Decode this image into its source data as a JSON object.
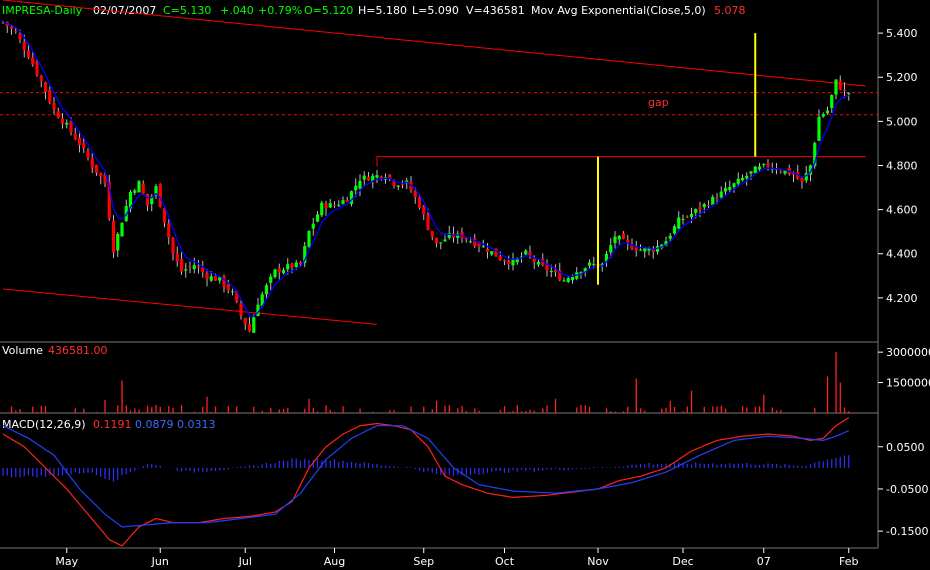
{
  "header": {
    "symbol": "IMPRESA-Daily",
    "date": "02/07/2007",
    "close": "C=5.130",
    "change": "+.040",
    "change_pct": "+0.79%",
    "open": "O=5.120",
    "high": "H=5.180",
    "low": "L=5.090",
    "volume": "V=436581",
    "indicator": "Mov Avg Exponential(Close,5,0)",
    "indicator_value": "5.078"
  },
  "volume_panel": {
    "title": "Volume",
    "value": "436581.00"
  },
  "macd_panel": {
    "title": "MACD(12,26,9)",
    "v1": "0.1191",
    "v2": "0.0879",
    "v3": "0.0313"
  },
  "annotation": {
    "gap_label": "gap"
  },
  "colors": {
    "background": "#000000",
    "up_candle": "#00ff00",
    "down_candle": "#ff0000",
    "ema": "#0000ff",
    "trendline": "#ff0000",
    "marker": "#ffff00",
    "axis_text": "#ffffff"
  },
  "chart_data": [
    {
      "type": "candlestick",
      "title": "IMPRESA-Daily",
      "ylim": [
        4.0,
        5.55
      ],
      "yticks": [
        "4.200",
        "4.400",
        "4.600",
        "4.800",
        "5.000",
        "5.200",
        "5.400"
      ],
      "ytick_values": [
        4.2,
        4.4,
        4.6,
        4.8,
        5.0,
        5.2,
        5.4
      ],
      "xticks": [
        "May",
        "Jun",
        "Jul",
        "Aug",
        "Sep",
        "Oct",
        "Nov",
        "Dec",
        "07",
        "Feb"
      ],
      "anchors": [
        [
          0,
          5.45
        ],
        [
          3,
          5.4
        ],
        [
          6,
          5.3
        ],
        [
          9,
          5.18
        ],
        [
          12,
          5.05
        ],
        [
          15,
          4.98
        ],
        [
          18,
          4.9
        ],
        [
          21,
          4.8
        ],
        [
          24,
          4.72
        ],
        [
          26,
          4.42
        ],
        [
          28,
          4.55
        ],
        [
          30,
          4.68
        ],
        [
          32,
          4.72
        ],
        [
          34,
          4.62
        ],
        [
          36,
          4.7
        ],
        [
          38,
          4.55
        ],
        [
          40,
          4.4
        ],
        [
          42,
          4.32
        ],
        [
          45,
          4.35
        ],
        [
          48,
          4.3
        ],
        [
          51,
          4.28
        ],
        [
          54,
          4.22
        ],
        [
          56,
          4.12
        ],
        [
          58,
          4.05
        ],
        [
          60,
          4.18
        ],
        [
          62,
          4.25
        ],
        [
          64,
          4.32
        ],
        [
          67,
          4.34
        ],
        [
          70,
          4.35
        ],
        [
          72,
          4.5
        ],
        [
          75,
          4.62
        ],
        [
          78,
          4.62
        ],
        [
          81,
          4.65
        ],
        [
          84,
          4.74
        ],
        [
          87,
          4.75
        ],
        [
          90,
          4.76
        ],
        [
          92,
          4.72
        ],
        [
          95,
          4.72
        ],
        [
          98,
          4.62
        ],
        [
          100,
          4.52
        ],
        [
          102,
          4.44
        ],
        [
          105,
          4.48
        ],
        [
          108,
          4.48
        ],
        [
          111,
          4.45
        ],
        [
          114,
          4.42
        ],
        [
          117,
          4.38
        ],
        [
          120,
          4.36
        ],
        [
          123,
          4.4
        ],
        [
          126,
          4.35
        ],
        [
          129,
          4.32
        ],
        [
          132,
          4.28
        ],
        [
          135,
          4.32
        ],
        [
          138,
          4.35
        ],
        [
          141,
          4.35
        ],
        [
          144,
          4.48
        ],
        [
          147,
          4.44
        ],
        [
          150,
          4.42
        ],
        [
          153,
          4.42
        ],
        [
          156,
          4.46
        ],
        [
          159,
          4.55
        ],
        [
          162,
          4.58
        ],
        [
          165,
          4.62
        ],
        [
          168,
          4.66
        ],
        [
          171,
          4.7
        ],
        [
          174,
          4.74
        ],
        [
          177,
          4.78
        ],
        [
          180,
          4.8
        ],
        [
          183,
          4.78
        ],
        [
          186,
          4.76
        ],
        [
          188,
          4.72
        ],
        [
          190,
          4.8
        ],
        [
          192,
          5.02
        ],
        [
          194,
          5.05
        ],
        [
          196,
          5.18
        ],
        [
          198,
          5.13
        ]
      ],
      "series": [
        {
          "name": "Mov Avg Exponential(Close,5,0)",
          "last": 5.078
        }
      ],
      "annotations": {
        "trendline_top": [
          [
            0,
            5.55
          ],
          [
            203,
            5.16
          ]
        ],
        "trendline_bottom": [
          [
            0,
            4.24
          ],
          [
            88,
            4.08
          ]
        ],
        "resistance": {
          "y": 4.84,
          "x": [
            88,
            203
          ]
        },
        "gap_lines": [
          5.13,
          5.03
        ],
        "gap_label": "gap",
        "marker_lines": [
          {
            "x": 140,
            "y0": 4.26,
            "y1": 4.84
          },
          {
            "x": 177,
            "y0": 4.84,
            "y1": 5.4
          }
        ]
      }
    },
    {
      "type": "bar",
      "title": "Volume",
      "last_value": 436581.0,
      "ylim": [
        0,
        3500000
      ],
      "yticks": [
        "3000000",
        "1500000"
      ],
      "ytick_values": [
        3000000,
        1500000
      ],
      "spikes": [
        [
          24,
          650000
        ],
        [
          28,
          1600000
        ],
        [
          48,
          800000
        ],
        [
          72,
          700000
        ],
        [
          102,
          600000
        ],
        [
          130,
          700000
        ],
        [
          149,
          1700000
        ],
        [
          157,
          600000
        ],
        [
          162,
          1100000
        ],
        [
          179,
          900000
        ],
        [
          194,
          1800000
        ],
        [
          196,
          3000000
        ],
        [
          197,
          1500000
        ]
      ]
    },
    {
      "type": "line",
      "title": "MACD(12,26,9)",
      "ylim": [
        -0.19,
        0.13
      ],
      "yticks": [
        "0.0500",
        "-0.0500",
        "-0.1500"
      ],
      "ytick_values": [
        0.05,
        -0.05,
        -0.15
      ],
      "series": [
        {
          "name": "0.1191",
          "points": [
            [
              0,
              0.08
            ],
            [
              5,
              0.05
            ],
            [
              10,
              0.0
            ],
            [
              15,
              -0.05
            ],
            [
              20,
              -0.11
            ],
            [
              25,
              -0.17
            ],
            [
              28,
              -0.185
            ],
            [
              32,
              -0.14
            ],
            [
              36,
              -0.12
            ],
            [
              40,
              -0.13
            ],
            [
              46,
              -0.13
            ],
            [
              52,
              -0.12
            ],
            [
              58,
              -0.115
            ],
            [
              64,
              -0.105
            ],
            [
              68,
              -0.08
            ],
            [
              72,
              0.0
            ],
            [
              76,
              0.05
            ],
            [
              80,
              0.08
            ],
            [
              84,
              0.1
            ],
            [
              88,
              0.105
            ],
            [
              92,
              0.1
            ],
            [
              96,
              0.09
            ],
            [
              100,
              0.05
            ],
            [
              104,
              -0.02
            ],
            [
              108,
              -0.04
            ],
            [
              114,
              -0.06
            ],
            [
              120,
              -0.07
            ],
            [
              128,
              -0.065
            ],
            [
              136,
              -0.055
            ],
            [
              140,
              -0.05
            ],
            [
              145,
              -0.03
            ],
            [
              150,
              -0.02
            ],
            [
              156,
              0.0
            ],
            [
              162,
              0.04
            ],
            [
              168,
              0.065
            ],
            [
              174,
              0.075
            ],
            [
              180,
              0.08
            ],
            [
              186,
              0.075
            ],
            [
              190,
              0.065
            ],
            [
              193,
              0.07
            ],
            [
              196,
              0.1
            ],
            [
              199,
              0.119
            ]
          ]
        },
        {
          "name": "0.0879",
          "points": [
            [
              0,
              0.1
            ],
            [
              6,
              0.07
            ],
            [
              12,
              0.03
            ],
            [
              18,
              -0.05
            ],
            [
              24,
              -0.11
            ],
            [
              28,
              -0.14
            ],
            [
              34,
              -0.135
            ],
            [
              40,
              -0.13
            ],
            [
              48,
              -0.13
            ],
            [
              56,
              -0.12
            ],
            [
              64,
              -0.11
            ],
            [
              70,
              -0.06
            ],
            [
              76,
              0.02
            ],
            [
              82,
              0.07
            ],
            [
              88,
              0.1
            ],
            [
              94,
              0.1
            ],
            [
              100,
              0.07
            ],
            [
              106,
              0.0
            ],
            [
              112,
              -0.04
            ],
            [
              120,
              -0.055
            ],
            [
              130,
              -0.06
            ],
            [
              140,
              -0.05
            ],
            [
              148,
              -0.035
            ],
            [
              156,
              -0.01
            ],
            [
              164,
              0.03
            ],
            [
              172,
              0.065
            ],
            [
              180,
              0.075
            ],
            [
              188,
              0.07
            ],
            [
              193,
              0.065
            ],
            [
              196,
              0.075
            ],
            [
              199,
              0.088
            ]
          ]
        },
        {
          "name": "0.0313",
          "type": "histogram",
          "points": [
            [
              0,
              -0.02
            ],
            [
              10,
              -0.02
            ],
            [
              20,
              -0.01
            ],
            [
              26,
              -0.03
            ],
            [
              34,
              0.01
            ],
            [
              44,
              -0.01
            ],
            [
              56,
              0.0
            ],
            [
              68,
              0.02
            ],
            [
              76,
              0.02
            ],
            [
              86,
              0.01
            ],
            [
              96,
              0.0
            ],
            [
              104,
              -0.02
            ],
            [
              116,
              -0.01
            ],
            [
              128,
              -0.005
            ],
            [
              140,
              0.0
            ],
            [
              152,
              0.01
            ],
            [
              164,
              0.01
            ],
            [
              176,
              0.01
            ],
            [
              188,
              0.005
            ],
            [
              194,
              0.02
            ],
            [
              199,
              0.031
            ]
          ]
        }
      ]
    }
  ]
}
